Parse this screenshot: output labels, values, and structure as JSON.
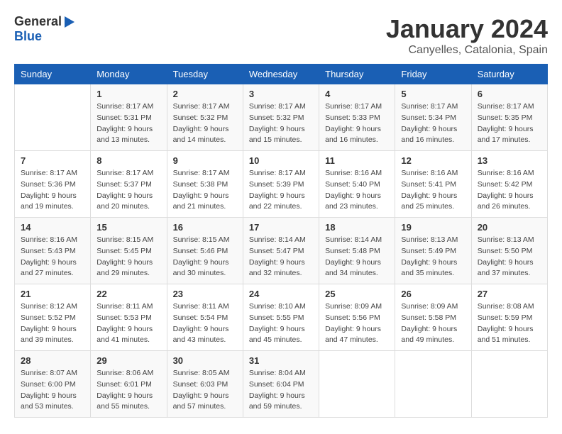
{
  "header": {
    "logo_general": "General",
    "logo_blue": "Blue",
    "month_title": "January 2024",
    "location": "Canyelles, Catalonia, Spain"
  },
  "days_of_week": [
    "Sunday",
    "Monday",
    "Tuesday",
    "Wednesday",
    "Thursday",
    "Friday",
    "Saturday"
  ],
  "weeks": [
    [
      {
        "day": "",
        "info": ""
      },
      {
        "day": "1",
        "info": "Sunrise: 8:17 AM\nSunset: 5:31 PM\nDaylight: 9 hours\nand 13 minutes."
      },
      {
        "day": "2",
        "info": "Sunrise: 8:17 AM\nSunset: 5:32 PM\nDaylight: 9 hours\nand 14 minutes."
      },
      {
        "day": "3",
        "info": "Sunrise: 8:17 AM\nSunset: 5:32 PM\nDaylight: 9 hours\nand 15 minutes."
      },
      {
        "day": "4",
        "info": "Sunrise: 8:17 AM\nSunset: 5:33 PM\nDaylight: 9 hours\nand 16 minutes."
      },
      {
        "day": "5",
        "info": "Sunrise: 8:17 AM\nSunset: 5:34 PM\nDaylight: 9 hours\nand 16 minutes."
      },
      {
        "day": "6",
        "info": "Sunrise: 8:17 AM\nSunset: 5:35 PM\nDaylight: 9 hours\nand 17 minutes."
      }
    ],
    [
      {
        "day": "7",
        "info": "Sunrise: 8:17 AM\nSunset: 5:36 PM\nDaylight: 9 hours\nand 19 minutes."
      },
      {
        "day": "8",
        "info": "Sunrise: 8:17 AM\nSunset: 5:37 PM\nDaylight: 9 hours\nand 20 minutes."
      },
      {
        "day": "9",
        "info": "Sunrise: 8:17 AM\nSunset: 5:38 PM\nDaylight: 9 hours\nand 21 minutes."
      },
      {
        "day": "10",
        "info": "Sunrise: 8:17 AM\nSunset: 5:39 PM\nDaylight: 9 hours\nand 22 minutes."
      },
      {
        "day": "11",
        "info": "Sunrise: 8:16 AM\nSunset: 5:40 PM\nDaylight: 9 hours\nand 23 minutes."
      },
      {
        "day": "12",
        "info": "Sunrise: 8:16 AM\nSunset: 5:41 PM\nDaylight: 9 hours\nand 25 minutes."
      },
      {
        "day": "13",
        "info": "Sunrise: 8:16 AM\nSunset: 5:42 PM\nDaylight: 9 hours\nand 26 minutes."
      }
    ],
    [
      {
        "day": "14",
        "info": "Sunrise: 8:16 AM\nSunset: 5:43 PM\nDaylight: 9 hours\nand 27 minutes."
      },
      {
        "day": "15",
        "info": "Sunrise: 8:15 AM\nSunset: 5:45 PM\nDaylight: 9 hours\nand 29 minutes."
      },
      {
        "day": "16",
        "info": "Sunrise: 8:15 AM\nSunset: 5:46 PM\nDaylight: 9 hours\nand 30 minutes."
      },
      {
        "day": "17",
        "info": "Sunrise: 8:14 AM\nSunset: 5:47 PM\nDaylight: 9 hours\nand 32 minutes."
      },
      {
        "day": "18",
        "info": "Sunrise: 8:14 AM\nSunset: 5:48 PM\nDaylight: 9 hours\nand 34 minutes."
      },
      {
        "day": "19",
        "info": "Sunrise: 8:13 AM\nSunset: 5:49 PM\nDaylight: 9 hours\nand 35 minutes."
      },
      {
        "day": "20",
        "info": "Sunrise: 8:13 AM\nSunset: 5:50 PM\nDaylight: 9 hours\nand 37 minutes."
      }
    ],
    [
      {
        "day": "21",
        "info": "Sunrise: 8:12 AM\nSunset: 5:52 PM\nDaylight: 9 hours\nand 39 minutes."
      },
      {
        "day": "22",
        "info": "Sunrise: 8:11 AM\nSunset: 5:53 PM\nDaylight: 9 hours\nand 41 minutes."
      },
      {
        "day": "23",
        "info": "Sunrise: 8:11 AM\nSunset: 5:54 PM\nDaylight: 9 hours\nand 43 minutes."
      },
      {
        "day": "24",
        "info": "Sunrise: 8:10 AM\nSunset: 5:55 PM\nDaylight: 9 hours\nand 45 minutes."
      },
      {
        "day": "25",
        "info": "Sunrise: 8:09 AM\nSunset: 5:56 PM\nDaylight: 9 hours\nand 47 minutes."
      },
      {
        "day": "26",
        "info": "Sunrise: 8:09 AM\nSunset: 5:58 PM\nDaylight: 9 hours\nand 49 minutes."
      },
      {
        "day": "27",
        "info": "Sunrise: 8:08 AM\nSunset: 5:59 PM\nDaylight: 9 hours\nand 51 minutes."
      }
    ],
    [
      {
        "day": "28",
        "info": "Sunrise: 8:07 AM\nSunset: 6:00 PM\nDaylight: 9 hours\nand 53 minutes."
      },
      {
        "day": "29",
        "info": "Sunrise: 8:06 AM\nSunset: 6:01 PM\nDaylight: 9 hours\nand 55 minutes."
      },
      {
        "day": "30",
        "info": "Sunrise: 8:05 AM\nSunset: 6:03 PM\nDaylight: 9 hours\nand 57 minutes."
      },
      {
        "day": "31",
        "info": "Sunrise: 8:04 AM\nSunset: 6:04 PM\nDaylight: 9 hours\nand 59 minutes."
      },
      {
        "day": "",
        "info": ""
      },
      {
        "day": "",
        "info": ""
      },
      {
        "day": "",
        "info": ""
      }
    ]
  ]
}
